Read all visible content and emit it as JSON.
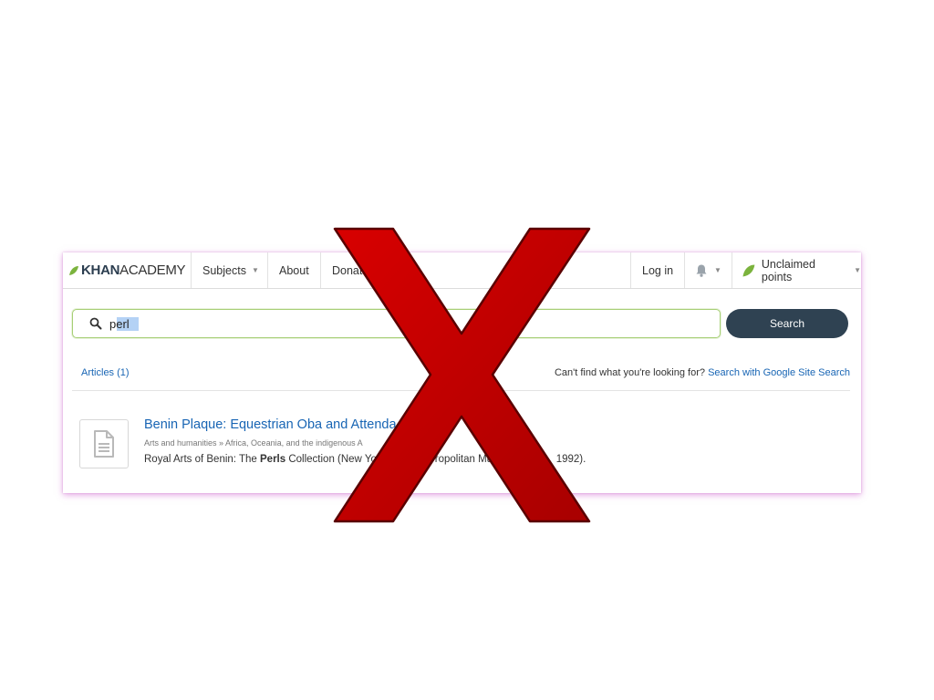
{
  "nav": {
    "logo_bold": "KHAN",
    "logo_light": "ACADEMY",
    "subjects_label": "Subjects",
    "about_label": "About",
    "donate_label": "Donat",
    "login_label": "Log in",
    "unclaimed_label": "Unclaimed points"
  },
  "search": {
    "query": "perl",
    "button_label": "Search"
  },
  "results_header": {
    "articles_tab": "Articles (1)",
    "cant_find_text": "Can't find what you're looking for?",
    "google_link": "Search with Google Site Search"
  },
  "results": [
    {
      "title": "Benin Plaque: Equestrian Oba and Attenda",
      "breadcrumb": "Arts and humanities » Africa, Oceania, and the indigenous A",
      "snippet_before": "Royal Arts of Benin: The ",
      "snippet_bold": "Perls",
      "snippet_after": " Collection (New Yo                    ropolitan Mus                    1992)."
    }
  ],
  "colors": {
    "brand_green": "#7bb33d",
    "link_blue": "#1865b4",
    "button_dark": "#2f4252",
    "x_red": "#c00000"
  }
}
